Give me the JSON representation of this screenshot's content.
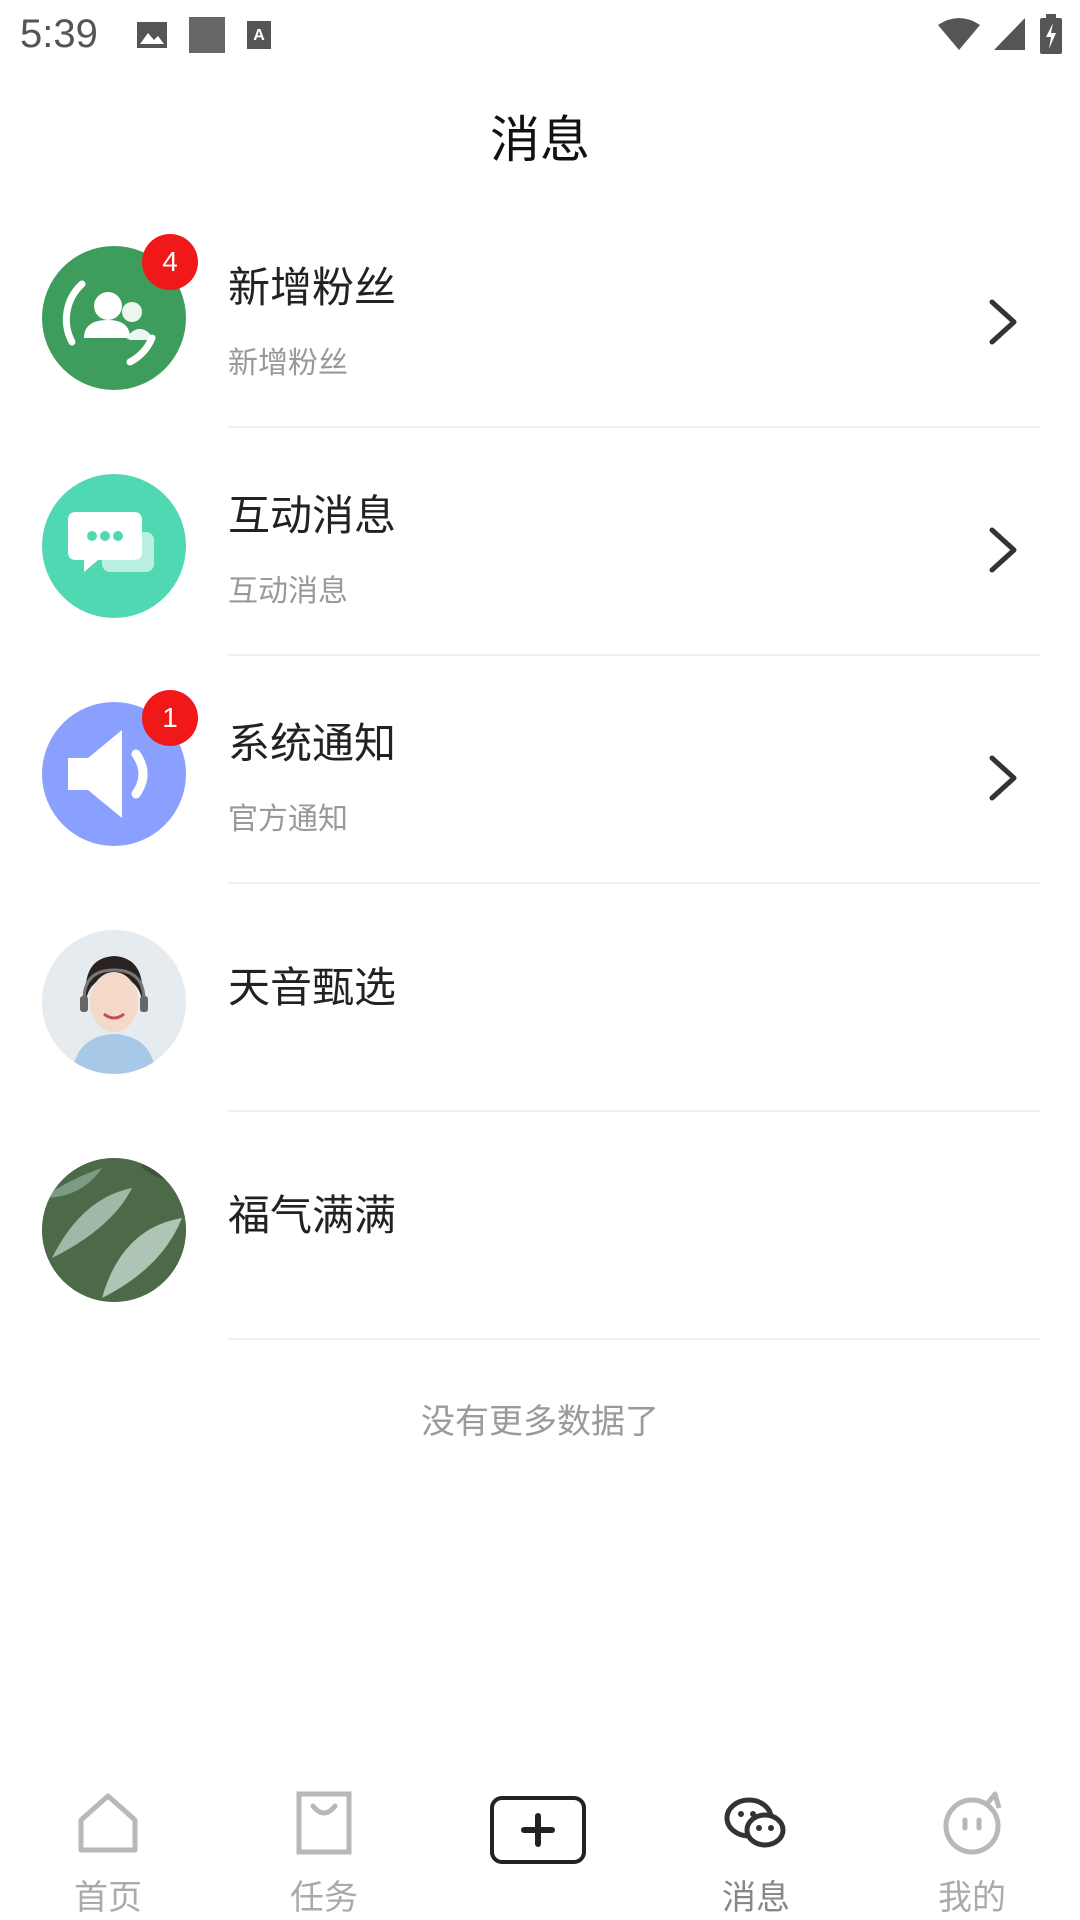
{
  "status_bar": {
    "time": "5:39"
  },
  "header": {
    "title": "消息"
  },
  "messages": [
    {
      "title": "新增粉丝",
      "subtitle": "新增粉丝",
      "badge": "4",
      "icon": "fans-icon",
      "color": "#3e9d5c"
    },
    {
      "title": "互动消息",
      "subtitle": "互动消息",
      "badge": "",
      "icon": "chat-bubble-icon",
      "color": "#4fd8b2"
    },
    {
      "title": "系统通知",
      "subtitle": "官方通知",
      "badge": "1",
      "icon": "speaker-icon",
      "color": "#8aa0ff"
    },
    {
      "title": "天音甄选",
      "subtitle": ""
    },
    {
      "title": "福气满满",
      "subtitle": ""
    }
  ],
  "list_footer": "没有更多数据了",
  "bottom_nav": {
    "items": [
      {
        "label": "首页",
        "icon": "home-icon"
      },
      {
        "label": "任务",
        "icon": "bag-icon"
      },
      {
        "label": "",
        "icon": "plus-icon"
      },
      {
        "label": "消息",
        "icon": "messages-icon",
        "active": true
      },
      {
        "label": "我的",
        "icon": "profile-face-icon"
      }
    ]
  }
}
